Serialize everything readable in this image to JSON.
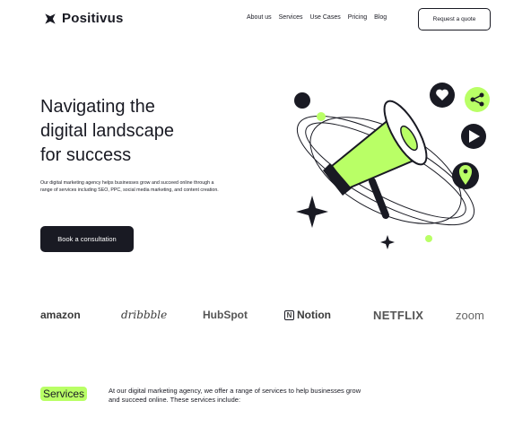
{
  "brand": {
    "name": "Positivus"
  },
  "nav": {
    "links": [
      "About us",
      "Services",
      "Use Cases",
      "Pricing",
      "Blog"
    ],
    "quote_button": "Request a quote"
  },
  "hero": {
    "title_line1": "Navigating the",
    "title_line2": "digital landscape",
    "title_line3": "for success",
    "description": "Our digital marketing agency helps businesses grow and succeed online through a range of services including SEO, PPC, social media marketing, and content creation.",
    "cta": "Book a consultation"
  },
  "logos": {
    "amazon": "amazon",
    "dribbble": "dribbble",
    "hubspot": "HubSpot",
    "notion": "Notion",
    "notion_mark": "N",
    "netflix": "NETFLIX",
    "zoom": "zoom"
  },
  "services": {
    "tag": "Services",
    "description": "At our digital marketing agency, we offer a range of services to help businesses grow and succeed online. These services include:"
  },
  "colors": {
    "accent": "#B9FF66",
    "dark": "#191A23"
  }
}
